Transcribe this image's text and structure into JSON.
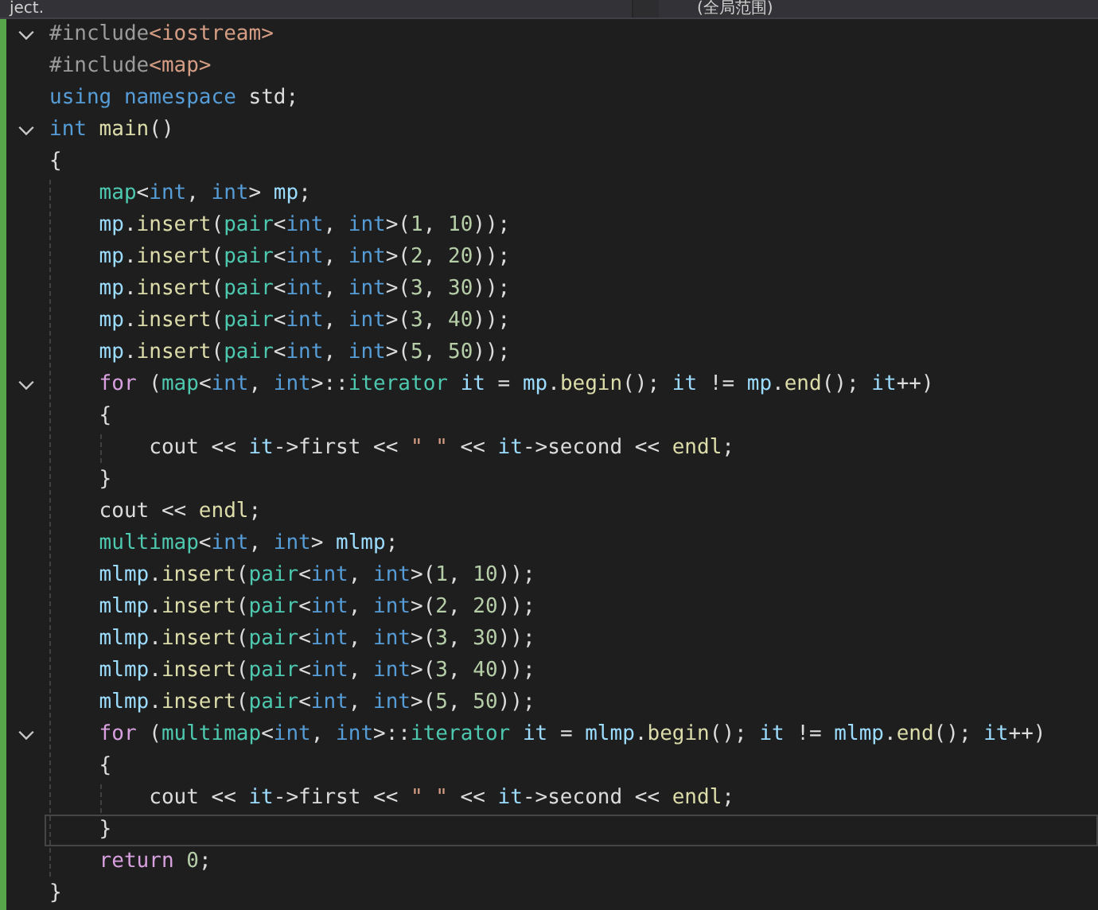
{
  "top_bar": {
    "project": "ject.",
    "scope": "(全局范围)"
  },
  "lines": [
    {
      "fold": true,
      "current": false,
      "tokens": [
        {
          "text": "#include",
          "kind": "pre"
        },
        {
          "text": "<iostream>",
          "kind": "inc"
        }
      ]
    },
    {
      "fold": false,
      "current": false,
      "tokens": [
        {
          "text": "#include",
          "kind": "pre"
        },
        {
          "text": "<map>",
          "kind": "inc"
        }
      ]
    },
    {
      "fold": false,
      "current": false,
      "tokens": [
        {
          "text": "using",
          "kind": "kw"
        },
        {
          "text": " namespace",
          "kind": "kw"
        },
        {
          "text": " std;",
          "kind": "p"
        }
      ]
    },
    {
      "fold": true,
      "current": false,
      "tokens": [
        {
          "text": "int",
          "kind": "kw"
        },
        {
          "text": " main",
          "kind": "fn"
        },
        {
          "text": "()",
          "kind": "p"
        }
      ]
    },
    {
      "fold": false,
      "current": false,
      "tokens": [
        {
          "text": "{",
          "kind": "p"
        }
      ]
    },
    {
      "fold": false,
      "current": false,
      "tokens": [
        {
          "text": "    map",
          "kind": "type"
        },
        {
          "text": "<",
          "kind": "p"
        },
        {
          "text": "int",
          "kind": "kw"
        },
        {
          "text": ", ",
          "kind": "p"
        },
        {
          "text": "int",
          "kind": "kw"
        },
        {
          "text": "> ",
          "kind": "p"
        },
        {
          "text": "mp",
          "kind": "var"
        },
        {
          "text": ";",
          "kind": "p"
        }
      ]
    },
    {
      "fold": false,
      "current": false,
      "tokens": [
        {
          "text": "    mp",
          "kind": "var"
        },
        {
          "text": ".",
          "kind": "p"
        },
        {
          "text": "insert",
          "kind": "fn"
        },
        {
          "text": "(",
          "kind": "p"
        },
        {
          "text": "pair",
          "kind": "type"
        },
        {
          "text": "<",
          "kind": "p"
        },
        {
          "text": "int",
          "kind": "kw"
        },
        {
          "text": ", ",
          "kind": "p"
        },
        {
          "text": "int",
          "kind": "kw"
        },
        {
          "text": ">(",
          "kind": "p"
        },
        {
          "text": "1",
          "kind": "num"
        },
        {
          "text": ", ",
          "kind": "p"
        },
        {
          "text": "10",
          "kind": "num"
        },
        {
          "text": "));",
          "kind": "p"
        }
      ]
    },
    {
      "fold": false,
      "current": false,
      "tokens": [
        {
          "text": "    mp",
          "kind": "var"
        },
        {
          "text": ".",
          "kind": "p"
        },
        {
          "text": "insert",
          "kind": "fn"
        },
        {
          "text": "(",
          "kind": "p"
        },
        {
          "text": "pair",
          "kind": "type"
        },
        {
          "text": "<",
          "kind": "p"
        },
        {
          "text": "int",
          "kind": "kw"
        },
        {
          "text": ", ",
          "kind": "p"
        },
        {
          "text": "int",
          "kind": "kw"
        },
        {
          "text": ">(",
          "kind": "p"
        },
        {
          "text": "2",
          "kind": "num"
        },
        {
          "text": ", ",
          "kind": "p"
        },
        {
          "text": "20",
          "kind": "num"
        },
        {
          "text": "));",
          "kind": "p"
        }
      ]
    },
    {
      "fold": false,
      "current": false,
      "tokens": [
        {
          "text": "    mp",
          "kind": "var"
        },
        {
          "text": ".",
          "kind": "p"
        },
        {
          "text": "insert",
          "kind": "fn"
        },
        {
          "text": "(",
          "kind": "p"
        },
        {
          "text": "pair",
          "kind": "type"
        },
        {
          "text": "<",
          "kind": "p"
        },
        {
          "text": "int",
          "kind": "kw"
        },
        {
          "text": ", ",
          "kind": "p"
        },
        {
          "text": "int",
          "kind": "kw"
        },
        {
          "text": ">(",
          "kind": "p"
        },
        {
          "text": "3",
          "kind": "num"
        },
        {
          "text": ", ",
          "kind": "p"
        },
        {
          "text": "30",
          "kind": "num"
        },
        {
          "text": "));",
          "kind": "p"
        }
      ]
    },
    {
      "fold": false,
      "current": false,
      "tokens": [
        {
          "text": "    mp",
          "kind": "var"
        },
        {
          "text": ".",
          "kind": "p"
        },
        {
          "text": "insert",
          "kind": "fn"
        },
        {
          "text": "(",
          "kind": "p"
        },
        {
          "text": "pair",
          "kind": "type"
        },
        {
          "text": "<",
          "kind": "p"
        },
        {
          "text": "int",
          "kind": "kw"
        },
        {
          "text": ", ",
          "kind": "p"
        },
        {
          "text": "int",
          "kind": "kw"
        },
        {
          "text": ">(",
          "kind": "p"
        },
        {
          "text": "3",
          "kind": "num"
        },
        {
          "text": ", ",
          "kind": "p"
        },
        {
          "text": "40",
          "kind": "num"
        },
        {
          "text": "));",
          "kind": "p"
        }
      ]
    },
    {
      "fold": false,
      "current": false,
      "tokens": [
        {
          "text": "    mp",
          "kind": "var"
        },
        {
          "text": ".",
          "kind": "p"
        },
        {
          "text": "insert",
          "kind": "fn"
        },
        {
          "text": "(",
          "kind": "p"
        },
        {
          "text": "pair",
          "kind": "type"
        },
        {
          "text": "<",
          "kind": "p"
        },
        {
          "text": "int",
          "kind": "kw"
        },
        {
          "text": ", ",
          "kind": "p"
        },
        {
          "text": "int",
          "kind": "kw"
        },
        {
          "text": ">(",
          "kind": "p"
        },
        {
          "text": "5",
          "kind": "num"
        },
        {
          "text": ", ",
          "kind": "p"
        },
        {
          "text": "50",
          "kind": "num"
        },
        {
          "text": "));",
          "kind": "p"
        }
      ]
    },
    {
      "fold": true,
      "current": false,
      "tokens": [
        {
          "text": "    for",
          "kind": "ctl"
        },
        {
          "text": " (",
          "kind": "p"
        },
        {
          "text": "map",
          "kind": "type"
        },
        {
          "text": "<",
          "kind": "p"
        },
        {
          "text": "int",
          "kind": "kw"
        },
        {
          "text": ", ",
          "kind": "p"
        },
        {
          "text": "int",
          "kind": "kw"
        },
        {
          "text": ">::",
          "kind": "p"
        },
        {
          "text": "iterator",
          "kind": "type"
        },
        {
          "text": " it",
          "kind": "var"
        },
        {
          "text": " = ",
          "kind": "p"
        },
        {
          "text": "mp",
          "kind": "var"
        },
        {
          "text": ".",
          "kind": "p"
        },
        {
          "text": "begin",
          "kind": "fn"
        },
        {
          "text": "(); ",
          "kind": "p"
        },
        {
          "text": "it",
          "kind": "var"
        },
        {
          "text": " != ",
          "kind": "p"
        },
        {
          "text": "mp",
          "kind": "var"
        },
        {
          "text": ".",
          "kind": "p"
        },
        {
          "text": "end",
          "kind": "fn"
        },
        {
          "text": "(); ",
          "kind": "p"
        },
        {
          "text": "it",
          "kind": "var"
        },
        {
          "text": "++)",
          "kind": "p"
        }
      ]
    },
    {
      "fold": false,
      "current": false,
      "tokens": [
        {
          "text": "    {",
          "kind": "p"
        }
      ]
    },
    {
      "fold": false,
      "current": false,
      "tokens": [
        {
          "text": "        cout << ",
          "kind": "p"
        },
        {
          "text": "it",
          "kind": "var"
        },
        {
          "text": "->first << ",
          "kind": "p"
        },
        {
          "text": "\" \"",
          "kind": "str"
        },
        {
          "text": " << ",
          "kind": "p"
        },
        {
          "text": "it",
          "kind": "var"
        },
        {
          "text": "->second << ",
          "kind": "p"
        },
        {
          "text": "endl",
          "kind": "fn"
        },
        {
          "text": ";",
          "kind": "p"
        }
      ]
    },
    {
      "fold": false,
      "current": false,
      "tokens": [
        {
          "text": "    }",
          "kind": "p"
        }
      ]
    },
    {
      "fold": false,
      "current": false,
      "tokens": [
        {
          "text": "    cout << ",
          "kind": "p"
        },
        {
          "text": "endl",
          "kind": "fn"
        },
        {
          "text": ";",
          "kind": "p"
        }
      ]
    },
    {
      "fold": false,
      "current": false,
      "tokens": [
        {
          "text": "    multimap",
          "kind": "type"
        },
        {
          "text": "<",
          "kind": "p"
        },
        {
          "text": "int",
          "kind": "kw"
        },
        {
          "text": ", ",
          "kind": "p"
        },
        {
          "text": "int",
          "kind": "kw"
        },
        {
          "text": "> ",
          "kind": "p"
        },
        {
          "text": "mlmp",
          "kind": "var"
        },
        {
          "text": ";",
          "kind": "p"
        }
      ]
    },
    {
      "fold": false,
      "current": false,
      "tokens": [
        {
          "text": "    mlmp",
          "kind": "var"
        },
        {
          "text": ".",
          "kind": "p"
        },
        {
          "text": "insert",
          "kind": "fn"
        },
        {
          "text": "(",
          "kind": "p"
        },
        {
          "text": "pair",
          "kind": "type"
        },
        {
          "text": "<",
          "kind": "p"
        },
        {
          "text": "int",
          "kind": "kw"
        },
        {
          "text": ", ",
          "kind": "p"
        },
        {
          "text": "int",
          "kind": "kw"
        },
        {
          "text": ">(",
          "kind": "p"
        },
        {
          "text": "1",
          "kind": "num"
        },
        {
          "text": ", ",
          "kind": "p"
        },
        {
          "text": "10",
          "kind": "num"
        },
        {
          "text": "));",
          "kind": "p"
        }
      ]
    },
    {
      "fold": false,
      "current": false,
      "tokens": [
        {
          "text": "    mlmp",
          "kind": "var"
        },
        {
          "text": ".",
          "kind": "p"
        },
        {
          "text": "insert",
          "kind": "fn"
        },
        {
          "text": "(",
          "kind": "p"
        },
        {
          "text": "pair",
          "kind": "type"
        },
        {
          "text": "<",
          "kind": "p"
        },
        {
          "text": "int",
          "kind": "kw"
        },
        {
          "text": ", ",
          "kind": "p"
        },
        {
          "text": "int",
          "kind": "kw"
        },
        {
          "text": ">(",
          "kind": "p"
        },
        {
          "text": "2",
          "kind": "num"
        },
        {
          "text": ", ",
          "kind": "p"
        },
        {
          "text": "20",
          "kind": "num"
        },
        {
          "text": "));",
          "kind": "p"
        }
      ]
    },
    {
      "fold": false,
      "current": false,
      "tokens": [
        {
          "text": "    mlmp",
          "kind": "var"
        },
        {
          "text": ".",
          "kind": "p"
        },
        {
          "text": "insert",
          "kind": "fn"
        },
        {
          "text": "(",
          "kind": "p"
        },
        {
          "text": "pair",
          "kind": "type"
        },
        {
          "text": "<",
          "kind": "p"
        },
        {
          "text": "int",
          "kind": "kw"
        },
        {
          "text": ", ",
          "kind": "p"
        },
        {
          "text": "int",
          "kind": "kw"
        },
        {
          "text": ">(",
          "kind": "p"
        },
        {
          "text": "3",
          "kind": "num"
        },
        {
          "text": ", ",
          "kind": "p"
        },
        {
          "text": "30",
          "kind": "num"
        },
        {
          "text": "));",
          "kind": "p"
        }
      ]
    },
    {
      "fold": false,
      "current": false,
      "tokens": [
        {
          "text": "    mlmp",
          "kind": "var"
        },
        {
          "text": ".",
          "kind": "p"
        },
        {
          "text": "insert",
          "kind": "fn"
        },
        {
          "text": "(",
          "kind": "p"
        },
        {
          "text": "pair",
          "kind": "type"
        },
        {
          "text": "<",
          "kind": "p"
        },
        {
          "text": "int",
          "kind": "kw"
        },
        {
          "text": ", ",
          "kind": "p"
        },
        {
          "text": "int",
          "kind": "kw"
        },
        {
          "text": ">(",
          "kind": "p"
        },
        {
          "text": "3",
          "kind": "num"
        },
        {
          "text": ", ",
          "kind": "p"
        },
        {
          "text": "40",
          "kind": "num"
        },
        {
          "text": "));",
          "kind": "p"
        }
      ]
    },
    {
      "fold": false,
      "current": false,
      "tokens": [
        {
          "text": "    mlmp",
          "kind": "var"
        },
        {
          "text": ".",
          "kind": "p"
        },
        {
          "text": "insert",
          "kind": "fn"
        },
        {
          "text": "(",
          "kind": "p"
        },
        {
          "text": "pair",
          "kind": "type"
        },
        {
          "text": "<",
          "kind": "p"
        },
        {
          "text": "int",
          "kind": "kw"
        },
        {
          "text": ", ",
          "kind": "p"
        },
        {
          "text": "int",
          "kind": "kw"
        },
        {
          "text": ">(",
          "kind": "p"
        },
        {
          "text": "5",
          "kind": "num"
        },
        {
          "text": ", ",
          "kind": "p"
        },
        {
          "text": "50",
          "kind": "num"
        },
        {
          "text": "));",
          "kind": "p"
        }
      ]
    },
    {
      "fold": true,
      "current": false,
      "tokens": [
        {
          "text": "    for",
          "kind": "ctl"
        },
        {
          "text": " (",
          "kind": "p"
        },
        {
          "text": "multimap",
          "kind": "type"
        },
        {
          "text": "<",
          "kind": "p"
        },
        {
          "text": "int",
          "kind": "kw"
        },
        {
          "text": ", ",
          "kind": "p"
        },
        {
          "text": "int",
          "kind": "kw"
        },
        {
          "text": ">::",
          "kind": "p"
        },
        {
          "text": "iterator",
          "kind": "type"
        },
        {
          "text": " it",
          "kind": "var"
        },
        {
          "text": " = ",
          "kind": "p"
        },
        {
          "text": "mlmp",
          "kind": "var"
        },
        {
          "text": ".",
          "kind": "p"
        },
        {
          "text": "begin",
          "kind": "fn"
        },
        {
          "text": "(); ",
          "kind": "p"
        },
        {
          "text": "it",
          "kind": "var"
        },
        {
          "text": " != ",
          "kind": "p"
        },
        {
          "text": "mlmp",
          "kind": "var"
        },
        {
          "text": ".",
          "kind": "p"
        },
        {
          "text": "end",
          "kind": "fn"
        },
        {
          "text": "(); ",
          "kind": "p"
        },
        {
          "text": "it",
          "kind": "var"
        },
        {
          "text": "++)",
          "kind": "p"
        }
      ]
    },
    {
      "fold": false,
      "current": false,
      "tokens": [
        {
          "text": "    {",
          "kind": "p"
        }
      ]
    },
    {
      "fold": false,
      "current": false,
      "tokens": [
        {
          "text": "        cout << ",
          "kind": "p"
        },
        {
          "text": "it",
          "kind": "var"
        },
        {
          "text": "->first << ",
          "kind": "p"
        },
        {
          "text": "\" \"",
          "kind": "str"
        },
        {
          "text": " << ",
          "kind": "p"
        },
        {
          "text": "it",
          "kind": "var"
        },
        {
          "text": "->second << ",
          "kind": "p"
        },
        {
          "text": "endl",
          "kind": "fn"
        },
        {
          "text": ";",
          "kind": "p"
        }
      ]
    },
    {
      "fold": false,
      "current": true,
      "tokens": [
        {
          "text": "    }",
          "kind": "p"
        }
      ]
    },
    {
      "fold": false,
      "current": false,
      "tokens": [
        {
          "text": "    return",
          "kind": "ctl"
        },
        {
          "text": " 0",
          "kind": "num"
        },
        {
          "text": ";",
          "kind": "p"
        }
      ]
    },
    {
      "fold": false,
      "current": false,
      "tokens": [
        {
          "text": "}",
          "kind": "p"
        }
      ]
    }
  ]
}
